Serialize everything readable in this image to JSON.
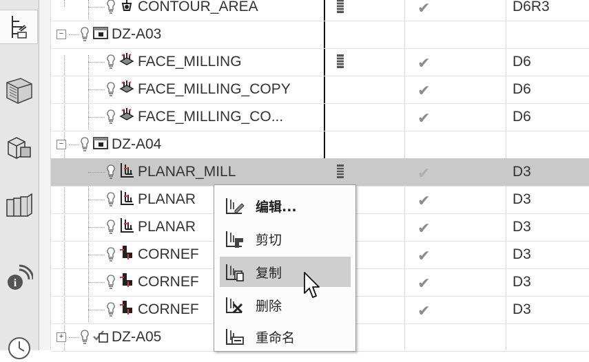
{
  "sidebar": {
    "buttons": [
      {
        "name": "operation-navigator-icon",
        "active": true
      },
      {
        "name": "machine-tool-icon",
        "active": false
      },
      {
        "name": "part-navigator-icon",
        "active": false
      },
      {
        "name": "reuse-library-icon",
        "active": false
      },
      {
        "name": "roles-icon",
        "active": false
      },
      {
        "name": "history-icon",
        "active": false
      }
    ]
  },
  "tree": {
    "rows": [
      {
        "type": "operation",
        "name": "CONTOUR_AREA",
        "icon": "contour-area-op-icon",
        "path": true,
        "status": true,
        "tool": "D6R3"
      },
      {
        "type": "group",
        "name": "DZ-A03",
        "expanded": true
      },
      {
        "type": "operation",
        "name": "FACE_MILLING",
        "icon": "face-milling-op-icon",
        "path": true,
        "status": true,
        "tool": "D6"
      },
      {
        "type": "operation",
        "name": "FACE_MILLING_COPY",
        "icon": "face-milling-op-icon",
        "path": false,
        "status": true,
        "tool": "D6"
      },
      {
        "type": "operation",
        "name": "FACE_MILLING_CO...",
        "icon": "face-milling-op-icon",
        "path": false,
        "status": true,
        "tool": "D6"
      },
      {
        "type": "group",
        "name": "DZ-A04",
        "expanded": true
      },
      {
        "type": "operation",
        "name": "PLANAR_MILL",
        "icon": "planar-mill-op-icon",
        "path": true,
        "status": true,
        "tool": "D3",
        "selected": true
      },
      {
        "type": "operation",
        "name": "PLANAR",
        "icon": "planar-mill-op-icon",
        "path": false,
        "status": true,
        "tool": "D3"
      },
      {
        "type": "operation",
        "name": "PLANAR",
        "icon": "planar-mill-op-icon",
        "path": false,
        "status": true,
        "tool": "D3"
      },
      {
        "type": "operation",
        "name": "CORNEF",
        "icon": "corner-op-icon",
        "path": false,
        "status": true,
        "tool": "D3"
      },
      {
        "type": "operation",
        "name": "CORNEF",
        "icon": "corner-op-icon",
        "path": false,
        "status": true,
        "tool": "D3"
      },
      {
        "type": "operation",
        "name": "CORNEF",
        "icon": "corner-op-icon",
        "path": false,
        "status": true,
        "tool": "D3"
      },
      {
        "type": "group",
        "name": "DZ-A05",
        "expanded": false
      }
    ]
  },
  "context_menu": {
    "items": [
      {
        "label": "编辑...",
        "icon": "edit-icon"
      },
      {
        "label": "剪切",
        "icon": "cut-icon"
      },
      {
        "label": "复制",
        "icon": "copy-icon",
        "hover": true
      },
      {
        "label": "删除",
        "icon": "delete-icon"
      },
      {
        "label": "重命名",
        "icon": "rename-icon"
      }
    ]
  }
}
